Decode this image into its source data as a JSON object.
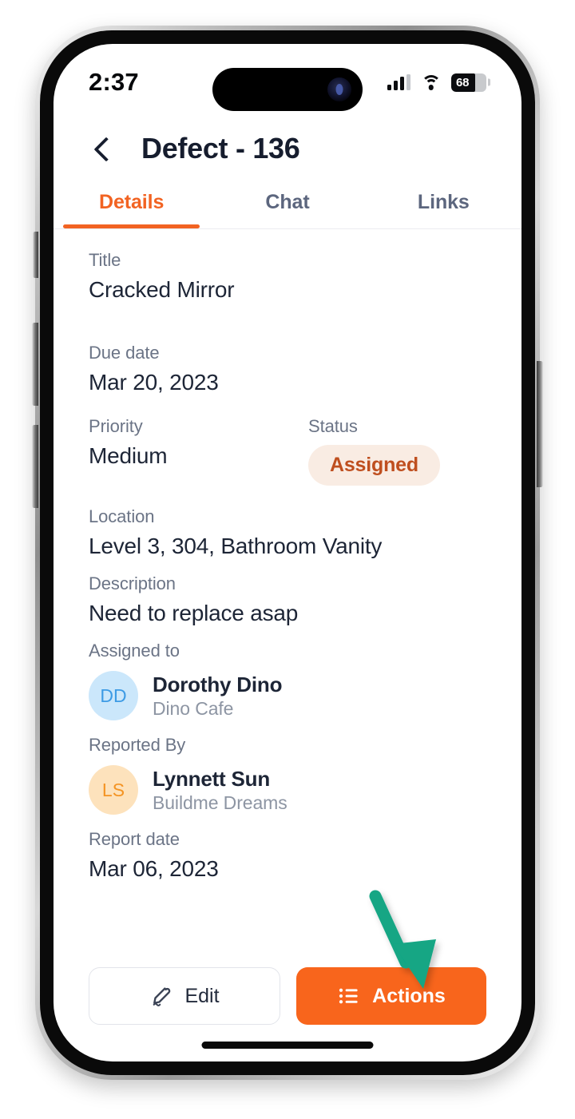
{
  "status_bar": {
    "time": "2:37",
    "cellular_icon": "cellular-bars-icon",
    "wifi_icon": "wifi-icon",
    "battery_icon": "battery-icon",
    "battery_percent": "68"
  },
  "nav": {
    "back_icon": "chevron-left-icon",
    "title": "Defect - 136"
  },
  "tabs": [
    {
      "label": "Details",
      "active": true
    },
    {
      "label": "Chat",
      "active": false
    },
    {
      "label": "Links",
      "active": false
    }
  ],
  "details": {
    "title": {
      "label": "Title",
      "value": "Cracked Mirror"
    },
    "due_date": {
      "label": "Due date",
      "value": "Mar 20, 2023"
    },
    "priority": {
      "label": "Priority",
      "value": "Medium"
    },
    "status": {
      "label": "Status",
      "value": "Assigned"
    },
    "location": {
      "label": "Location",
      "value": "Level 3, 304, Bathroom Vanity"
    },
    "description": {
      "label": "Description",
      "value": "Need to replace asap"
    },
    "assigned_to": {
      "label": "Assigned to",
      "initials": "DD",
      "name": "Dorothy Dino",
      "org": "Dino Cafe"
    },
    "reported_by": {
      "label": "Reported By",
      "initials": "LS",
      "name": "Lynnett Sun",
      "org": "Buildme Dreams"
    },
    "report_date": {
      "label": "Report date",
      "value": "Mar 06, 2023"
    }
  },
  "action_bar": {
    "edit": {
      "label": "Edit",
      "icon": "pencil-edit-icon"
    },
    "actions": {
      "label": "Actions",
      "icon": "list-bullet-icon"
    }
  },
  "annotation": {
    "arrow_icon": "green-arrow-pointing-down-right",
    "target": "Actions"
  },
  "colors": {
    "accent_orange": "#f26322",
    "button_orange": "#f8651c",
    "badge_bg": "#f9ece3",
    "badge_text": "#bf4f1f",
    "text_primary": "#1d2536",
    "text_muted": "#6b7486",
    "avatar_blue_bg": "#cbe7fb",
    "avatar_blue_text": "#3d9be5",
    "avatar_peach_bg": "#fde2bc",
    "avatar_peach_text": "#f49423",
    "annotation_green": "#12a684"
  }
}
